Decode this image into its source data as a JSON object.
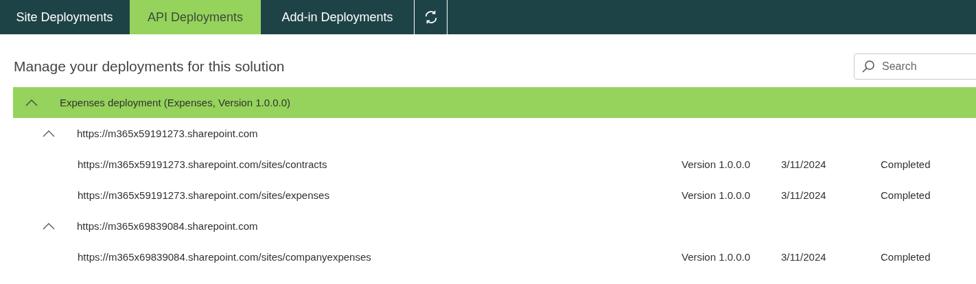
{
  "tabs": [
    {
      "label": "Site Deployments",
      "selected": false
    },
    {
      "label": "API Deployments",
      "selected": true
    },
    {
      "label": "Add-in Deployments",
      "selected": false
    }
  ],
  "heading": "Manage your deployments for this solution",
  "search": {
    "placeholder": "Search"
  },
  "deployments": [
    {
      "label": "Expenses deployment (Expenses, Version 1.0.0.0)",
      "expanded": true,
      "selected": true,
      "children": [
        {
          "label": "https://m365x59191273.sharepoint.com",
          "expanded": true,
          "children": [
            {
              "url": "https://m365x59191273.sharepoint.com/sites/contracts",
              "version": "Version 1.0.0.0",
              "date": "3/11/2024",
              "status": "Completed"
            },
            {
              "url": "https://m365x59191273.sharepoint.com/sites/expenses",
              "version": "Version 1.0.0.0",
              "date": "3/11/2024",
              "status": "Completed"
            }
          ]
        },
        {
          "label": "https://m365x69839084.sharepoint.com",
          "expanded": true,
          "children": [
            {
              "url": "https://m365x69839084.sharepoint.com/sites/companyexpenses",
              "version": "Version 1.0.0.0",
              "date": "3/11/2024",
              "status": "Completed"
            }
          ]
        }
      ]
    }
  ]
}
